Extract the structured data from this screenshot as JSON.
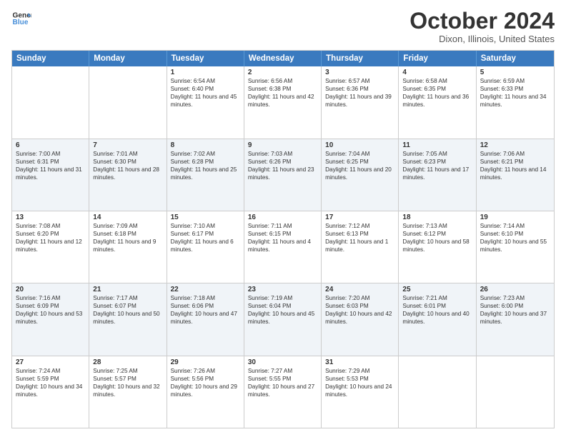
{
  "header": {
    "logo_line1": "General",
    "logo_line2": "Blue",
    "month": "October 2024",
    "location": "Dixon, Illinois, United States"
  },
  "weekdays": [
    "Sunday",
    "Monday",
    "Tuesday",
    "Wednesday",
    "Thursday",
    "Friday",
    "Saturday"
  ],
  "rows": [
    [
      {
        "day": "",
        "info": ""
      },
      {
        "day": "",
        "info": ""
      },
      {
        "day": "1",
        "info": "Sunrise: 6:54 AM\nSunset: 6:40 PM\nDaylight: 11 hours and 45 minutes."
      },
      {
        "day": "2",
        "info": "Sunrise: 6:56 AM\nSunset: 6:38 PM\nDaylight: 11 hours and 42 minutes."
      },
      {
        "day": "3",
        "info": "Sunrise: 6:57 AM\nSunset: 6:36 PM\nDaylight: 11 hours and 39 minutes."
      },
      {
        "day": "4",
        "info": "Sunrise: 6:58 AM\nSunset: 6:35 PM\nDaylight: 11 hours and 36 minutes."
      },
      {
        "day": "5",
        "info": "Sunrise: 6:59 AM\nSunset: 6:33 PM\nDaylight: 11 hours and 34 minutes."
      }
    ],
    [
      {
        "day": "6",
        "info": "Sunrise: 7:00 AM\nSunset: 6:31 PM\nDaylight: 11 hours and 31 minutes."
      },
      {
        "day": "7",
        "info": "Sunrise: 7:01 AM\nSunset: 6:30 PM\nDaylight: 11 hours and 28 minutes."
      },
      {
        "day": "8",
        "info": "Sunrise: 7:02 AM\nSunset: 6:28 PM\nDaylight: 11 hours and 25 minutes."
      },
      {
        "day": "9",
        "info": "Sunrise: 7:03 AM\nSunset: 6:26 PM\nDaylight: 11 hours and 23 minutes."
      },
      {
        "day": "10",
        "info": "Sunrise: 7:04 AM\nSunset: 6:25 PM\nDaylight: 11 hours and 20 minutes."
      },
      {
        "day": "11",
        "info": "Sunrise: 7:05 AM\nSunset: 6:23 PM\nDaylight: 11 hours and 17 minutes."
      },
      {
        "day": "12",
        "info": "Sunrise: 7:06 AM\nSunset: 6:21 PM\nDaylight: 11 hours and 14 minutes."
      }
    ],
    [
      {
        "day": "13",
        "info": "Sunrise: 7:08 AM\nSunset: 6:20 PM\nDaylight: 11 hours and 12 minutes."
      },
      {
        "day": "14",
        "info": "Sunrise: 7:09 AM\nSunset: 6:18 PM\nDaylight: 11 hours and 9 minutes."
      },
      {
        "day": "15",
        "info": "Sunrise: 7:10 AM\nSunset: 6:17 PM\nDaylight: 11 hours and 6 minutes."
      },
      {
        "day": "16",
        "info": "Sunrise: 7:11 AM\nSunset: 6:15 PM\nDaylight: 11 hours and 4 minutes."
      },
      {
        "day": "17",
        "info": "Sunrise: 7:12 AM\nSunset: 6:13 PM\nDaylight: 11 hours and 1 minute."
      },
      {
        "day": "18",
        "info": "Sunrise: 7:13 AM\nSunset: 6:12 PM\nDaylight: 10 hours and 58 minutes."
      },
      {
        "day": "19",
        "info": "Sunrise: 7:14 AM\nSunset: 6:10 PM\nDaylight: 10 hours and 55 minutes."
      }
    ],
    [
      {
        "day": "20",
        "info": "Sunrise: 7:16 AM\nSunset: 6:09 PM\nDaylight: 10 hours and 53 minutes."
      },
      {
        "day": "21",
        "info": "Sunrise: 7:17 AM\nSunset: 6:07 PM\nDaylight: 10 hours and 50 minutes."
      },
      {
        "day": "22",
        "info": "Sunrise: 7:18 AM\nSunset: 6:06 PM\nDaylight: 10 hours and 47 minutes."
      },
      {
        "day": "23",
        "info": "Sunrise: 7:19 AM\nSunset: 6:04 PM\nDaylight: 10 hours and 45 minutes."
      },
      {
        "day": "24",
        "info": "Sunrise: 7:20 AM\nSunset: 6:03 PM\nDaylight: 10 hours and 42 minutes."
      },
      {
        "day": "25",
        "info": "Sunrise: 7:21 AM\nSunset: 6:01 PM\nDaylight: 10 hours and 40 minutes."
      },
      {
        "day": "26",
        "info": "Sunrise: 7:23 AM\nSunset: 6:00 PM\nDaylight: 10 hours and 37 minutes."
      }
    ],
    [
      {
        "day": "27",
        "info": "Sunrise: 7:24 AM\nSunset: 5:59 PM\nDaylight: 10 hours and 34 minutes."
      },
      {
        "day": "28",
        "info": "Sunrise: 7:25 AM\nSunset: 5:57 PM\nDaylight: 10 hours and 32 minutes."
      },
      {
        "day": "29",
        "info": "Sunrise: 7:26 AM\nSunset: 5:56 PM\nDaylight: 10 hours and 29 minutes."
      },
      {
        "day": "30",
        "info": "Sunrise: 7:27 AM\nSunset: 5:55 PM\nDaylight: 10 hours and 27 minutes."
      },
      {
        "day": "31",
        "info": "Sunrise: 7:29 AM\nSunset: 5:53 PM\nDaylight: 10 hours and 24 minutes."
      },
      {
        "day": "",
        "info": ""
      },
      {
        "day": "",
        "info": ""
      }
    ]
  ]
}
